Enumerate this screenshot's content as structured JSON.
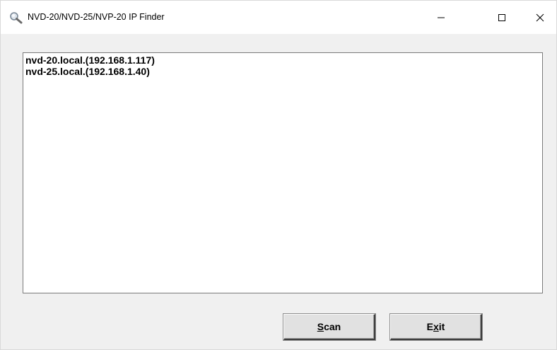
{
  "window": {
    "title": "NVD-20/NVD-25/NVP-20 IP Finder",
    "icon": "magnifier-icon",
    "controls": {
      "minimize_icon": "minimize-icon",
      "maximize_icon": "maximize-icon",
      "close_icon": "close-icon"
    }
  },
  "device_list": {
    "items": [
      "nvd-20.local.(192.168.1.117)",
      "nvd-25.local.(192.168.1.40)"
    ]
  },
  "buttons": {
    "scan": {
      "label_before": "",
      "mnemonic": "S",
      "label_after": "can"
    },
    "exit": {
      "label_before": "E",
      "mnemonic": "x",
      "label_after": "it"
    }
  },
  "colors": {
    "window_bg": "#f0f0f0",
    "titlebar_bg": "#ffffff",
    "list_bg": "#ffffff",
    "button_face": "#e1e1e1"
  }
}
